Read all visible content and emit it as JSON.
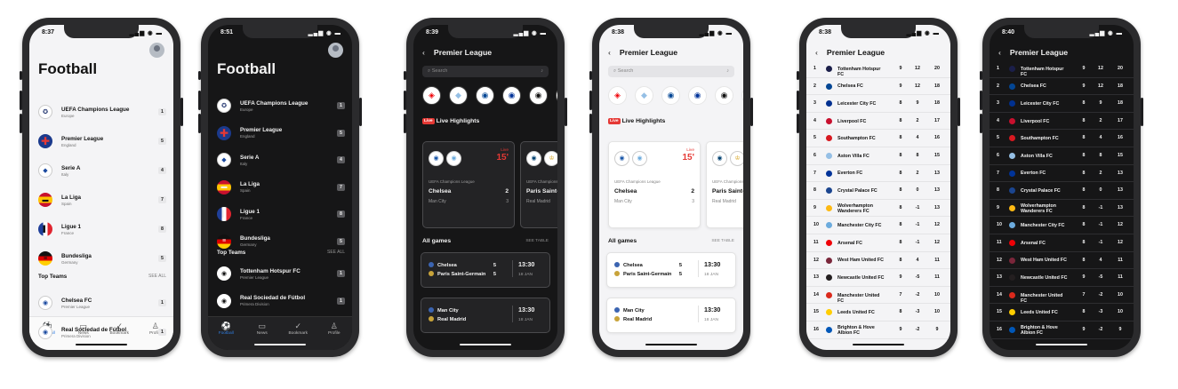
{
  "screens": [
    {
      "theme": "light",
      "time": "8:37",
      "title": "Football",
      "leagues": [
        {
          "name": "UEFA Champions League",
          "region": "Europe",
          "count": "1",
          "icon": "champions-league-icon"
        },
        {
          "name": "Premier League",
          "region": "England",
          "count": "5",
          "icon": "england-flag-icon"
        },
        {
          "name": "Serie A",
          "region": "Italy",
          "count": "4",
          "icon": "serie-a-icon"
        },
        {
          "name": "La Liga",
          "region": "Spain",
          "count": "7",
          "icon": "spain-flag-icon"
        },
        {
          "name": "Ligue 1",
          "region": "France",
          "count": "8",
          "icon": "france-flag-icon"
        },
        {
          "name": "Bundesliga",
          "region": "Germany",
          "count": "5",
          "icon": "germany-flag-icon"
        }
      ],
      "top_teams_title": "Top Teams",
      "see_all": "SEE ALL",
      "teams": [
        {
          "name": "Chelsea FC",
          "league": "Premier League",
          "count": "1"
        },
        {
          "name": "Real Sociedad de Fútbol",
          "league": "Primera Division",
          "count": "1"
        }
      ],
      "tabs": [
        "Football",
        "News",
        "Bookmark",
        "Profile"
      ]
    },
    {
      "theme": "dark",
      "time": "8:51",
      "title": "Football",
      "leagues": [
        {
          "name": "UEFA Champions League",
          "region": "Europe",
          "count": "1",
          "icon": "champions-league-icon"
        },
        {
          "name": "Premier League",
          "region": "England",
          "count": "5",
          "icon": "england-flag-icon"
        },
        {
          "name": "Serie A",
          "region": "Italy",
          "count": "4",
          "icon": "serie-a-icon"
        },
        {
          "name": "La Liga",
          "region": "Spain",
          "count": "7",
          "icon": "spain-flag-icon"
        },
        {
          "name": "Ligue 1",
          "region": "France",
          "count": "8",
          "icon": "france-flag-icon"
        },
        {
          "name": "Bundesliga",
          "region": "Germany",
          "count": "5",
          "icon": "germany-flag-icon"
        }
      ],
      "top_teams_title": "Top Teams",
      "see_all": "SEE ALL",
      "teams": [
        {
          "name": "Tottenham Hotspur FC",
          "league": "Premier League",
          "count": "1"
        },
        {
          "name": "Real Sociedad de Fútbol",
          "league": "Primera Division",
          "count": "1"
        }
      ],
      "tabs": [
        "Football",
        "News",
        "Bookmark",
        "Profile"
      ]
    },
    {
      "theme": "dark",
      "time": "8:39",
      "title": "Premier League",
      "search_placeholder": "Search",
      "live_badge": "Live",
      "live_title": "Live Highlights",
      "matches": [
        {
          "competition": "UEFA Champions League",
          "home": "Chelsea",
          "away": "Man City",
          "home_score": "2",
          "away_score": "3",
          "live_label": "Live",
          "minute": "15'"
        },
        {
          "competition": "UEFA Champions League",
          "home": "Paris Saint-Germain",
          "away": "Real Madrid"
        }
      ],
      "all_games_title": "All games",
      "see_table": "SEE TABLE",
      "games": [
        {
          "home": "Chelsea",
          "away": "Paris Saint-Germain",
          "home_score": "5",
          "away_score": "5",
          "time": "13:30",
          "date": "18 JAN"
        },
        {
          "home": "Man City",
          "away": "Real Madrid",
          "time": "13:30",
          "date": "18 JAN"
        }
      ]
    },
    {
      "theme": "light",
      "time": "8:38",
      "title": "Premier League",
      "search_placeholder": "Search",
      "live_badge": "Live",
      "live_title": "Live Highlights",
      "matches": [
        {
          "competition": "UEFA Champions League",
          "home": "Chelsea",
          "away": "Man City",
          "home_score": "2",
          "away_score": "3",
          "live_label": "Live",
          "minute": "15'"
        },
        {
          "competition": "UEFA Champions League",
          "home": "Paris Saint-Germain",
          "away": "Real Madrid"
        }
      ],
      "all_games_title": "All games",
      "see_table": "SEE TABLE",
      "games": [
        {
          "home": "Chelsea",
          "away": "Paris Saint-Germain",
          "home_score": "5",
          "away_score": "5",
          "time": "13:30",
          "date": "18 JAN"
        },
        {
          "home": "Man City",
          "away": "Real Madrid",
          "time": "13:30",
          "date": "18 JAN"
        }
      ]
    },
    {
      "theme": "light",
      "time": "8:38",
      "title": "Premier League",
      "table": [
        {
          "pos": "1",
          "team": "Tottenham Hotspur FC",
          "p": "9",
          "gd": "12",
          "pts": "20"
        },
        {
          "pos": "2",
          "team": "Chelsea FC",
          "p": "9",
          "gd": "12",
          "pts": "18"
        },
        {
          "pos": "3",
          "team": "Leicester City FC",
          "p": "8",
          "gd": "9",
          "pts": "18"
        },
        {
          "pos": "4",
          "team": "Liverpool FC",
          "p": "8",
          "gd": "2",
          "pts": "17"
        },
        {
          "pos": "5",
          "team": "Southampton FC",
          "p": "8",
          "gd": "4",
          "pts": "16"
        },
        {
          "pos": "6",
          "team": "Aston Villa FC",
          "p": "8",
          "gd": "8",
          "pts": "15"
        },
        {
          "pos": "7",
          "team": "Everton FC",
          "p": "8",
          "gd": "2",
          "pts": "13"
        },
        {
          "pos": "8",
          "team": "Crystal Palace FC",
          "p": "8",
          "gd": "0",
          "pts": "13"
        },
        {
          "pos": "9",
          "team": "Wolverhampton Wanderers FC",
          "p": "8",
          "gd": "-1",
          "pts": "13"
        },
        {
          "pos": "10",
          "team": "Manchester City FC",
          "p": "8",
          "gd": "-1",
          "pts": "12"
        },
        {
          "pos": "11",
          "team": "Arsenal FC",
          "p": "8",
          "gd": "-1",
          "pts": "12"
        },
        {
          "pos": "12",
          "team": "West Ham United FC",
          "p": "8",
          "gd": "4",
          "pts": "11"
        },
        {
          "pos": "13",
          "team": "Newcastle United FC",
          "p": "9",
          "gd": "-5",
          "pts": "11"
        },
        {
          "pos": "14",
          "team": "Manchester United FC",
          "p": "7",
          "gd": "-2",
          "pts": "10"
        },
        {
          "pos": "15",
          "team": "Leeds United FC",
          "p": "8",
          "gd": "-3",
          "pts": "10"
        },
        {
          "pos": "16",
          "team": "Brighton & Hove Albion FC",
          "p": "9",
          "gd": "-2",
          "pts": "9"
        }
      ]
    },
    {
      "theme": "dark",
      "time": "8:40",
      "title": "Premier League",
      "table": [
        {
          "pos": "1",
          "team": "Tottenham Hotspur FC",
          "p": "9",
          "gd": "12",
          "pts": "20"
        },
        {
          "pos": "2",
          "team": "Chelsea FC",
          "p": "9",
          "gd": "12",
          "pts": "18"
        },
        {
          "pos": "3",
          "team": "Leicester City FC",
          "p": "8",
          "gd": "9",
          "pts": "18"
        },
        {
          "pos": "4",
          "team": "Liverpool FC",
          "p": "8",
          "gd": "2",
          "pts": "17"
        },
        {
          "pos": "5",
          "team": "Southampton FC",
          "p": "8",
          "gd": "4",
          "pts": "16"
        },
        {
          "pos": "6",
          "team": "Aston Villa FC",
          "p": "8",
          "gd": "8",
          "pts": "15"
        },
        {
          "pos": "7",
          "team": "Everton FC",
          "p": "8",
          "gd": "2",
          "pts": "13"
        },
        {
          "pos": "8",
          "team": "Crystal Palace FC",
          "p": "8",
          "gd": "0",
          "pts": "13"
        },
        {
          "pos": "9",
          "team": "Wolverhampton Wanderers FC",
          "p": "8",
          "gd": "-1",
          "pts": "13"
        },
        {
          "pos": "10",
          "team": "Manchester City FC",
          "p": "8",
          "gd": "-1",
          "pts": "12"
        },
        {
          "pos": "11",
          "team": "Arsenal FC",
          "p": "8",
          "gd": "-1",
          "pts": "12"
        },
        {
          "pos": "12",
          "team": "West Ham United FC",
          "p": "8",
          "gd": "4",
          "pts": "11"
        },
        {
          "pos": "13",
          "team": "Newcastle United FC",
          "p": "9",
          "gd": "-5",
          "pts": "11"
        },
        {
          "pos": "14",
          "team": "Manchester United FC",
          "p": "7",
          "gd": "-2",
          "pts": "10"
        },
        {
          "pos": "15",
          "team": "Leeds United FC",
          "p": "8",
          "gd": "-3",
          "pts": "10"
        },
        {
          "pos": "16",
          "team": "Brighton & Hove Albion FC",
          "p": "9",
          "gd": "-2",
          "pts": "9"
        }
      ]
    }
  ],
  "colors": {
    "accent": "#2f7de1",
    "live": "#e53935",
    "dark_bg": "#161617",
    "light_bg": "#f4f4f6"
  }
}
